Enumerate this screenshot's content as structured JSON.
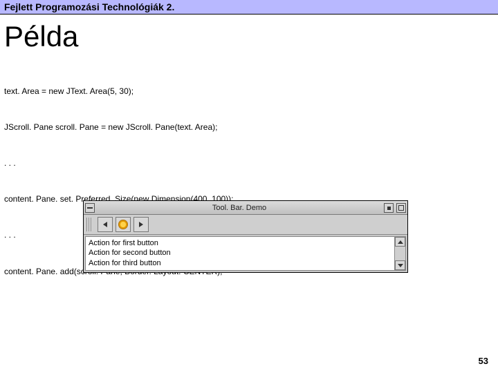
{
  "header": {
    "text": "Fejlett Programozási Technológiák 2."
  },
  "title": "Példa",
  "code": {
    "lines": [
      "text. Area = new JText. Area(5, 30);",
      "JScroll. Pane scroll. Pane = new JScroll. Pane(text. Area);",
      ". . .",
      "content. Pane. set. Preferred. Size(new Dimension(400, 100));",
      ". . .",
      "content. Pane. add(scroll. Pane, Border. Layout. CENTER);"
    ]
  },
  "demo": {
    "window_title": "Tool. Bar. Demo",
    "text_lines": [
      "Action for first button",
      "Action for second button",
      "Action for third button"
    ]
  },
  "page_number": "53"
}
